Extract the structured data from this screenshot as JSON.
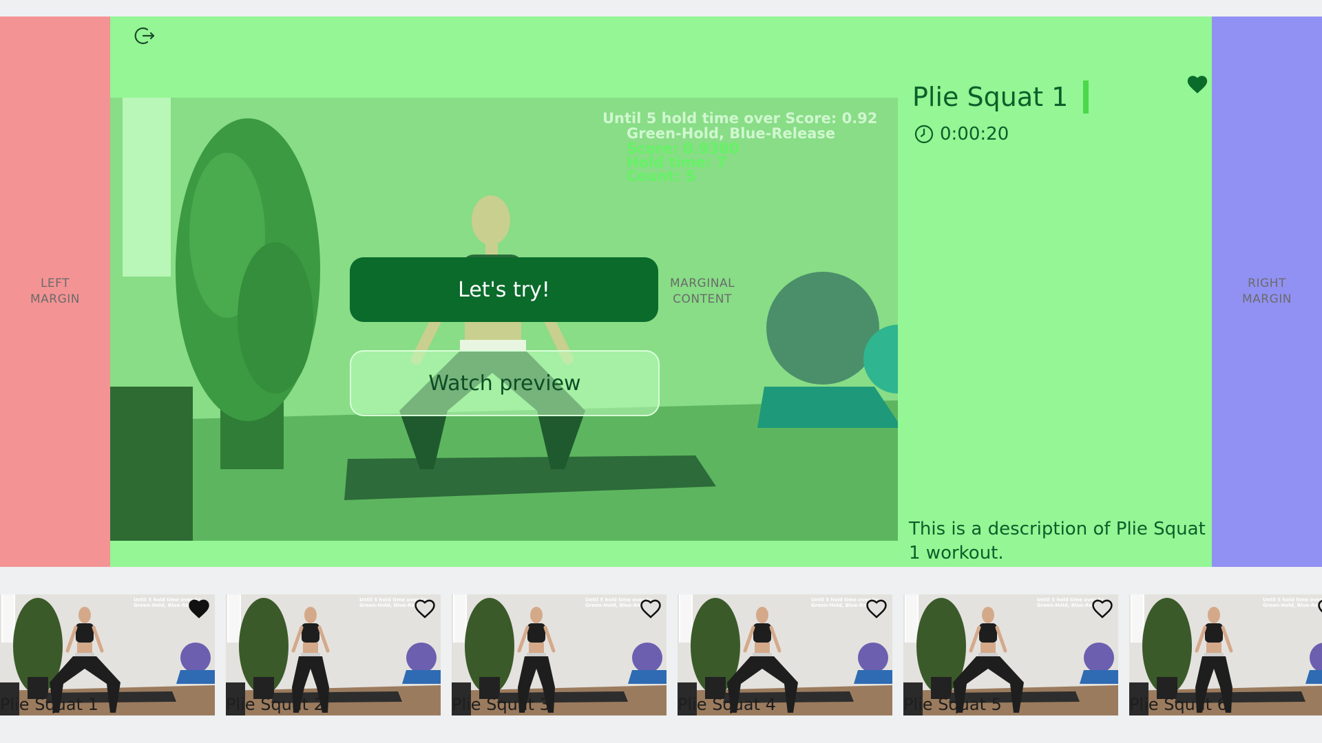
{
  "margins": {
    "left_label": "LEFT\nMARGIN",
    "right_label": "RIGHT\nMARGIN",
    "center_label": "MARGINAL\nCONTENT"
  },
  "video": {
    "overlay_lines": [
      "Until 5 hold time over Score: 0.92",
      "Green-Hold, Blue-Release",
      "Score: 0.9380",
      "Hold time: 7",
      "Count: 5"
    ]
  },
  "buttons": {
    "try_label": "Let's try!",
    "preview_label": "Watch preview"
  },
  "workout": {
    "title": "Plie Squat 1",
    "duration": "0:00:20",
    "description": "This is a description of Plie Squat 1 workout.",
    "favorited": true
  },
  "icons": {
    "exit": "exit-icon",
    "favorite": "heart-icon",
    "timer": "clock-icon"
  },
  "colors": {
    "content_bg": "#94f694",
    "left_margin": "#f49394",
    "right_margin": "#9191f3",
    "primary_button": "#0a6b2b",
    "accent_bar": "#4bd84b"
  },
  "carousel": {
    "items": [
      {
        "label": "Plie Squat 1",
        "favorited": true,
        "overlay": [
          "Until 5 hold time over Sc",
          "Green-Hold, Blue-Rel"
        ]
      },
      {
        "label": "Plie Squat 2",
        "favorited": false,
        "overlay": [
          "Until 5 hold time over Sc",
          "Green-Hold, Blue-Rel"
        ]
      },
      {
        "label": "Plie Squat 3",
        "favorited": false,
        "overlay": [
          "Until 5 hold time over Sc",
          "Green-Hold, Blue-Rel"
        ]
      },
      {
        "label": "Plie Squat 4",
        "favorited": false,
        "overlay": [
          "Until 5 hold time over Sc",
          "Green-Hold, Blue-Rel"
        ]
      },
      {
        "label": "Plie Squat 5",
        "favorited": false,
        "overlay": [
          "Until 5 hold time over Sc",
          "Green-Hold, Blue-Rel"
        ]
      },
      {
        "label": "Plie Squat 6",
        "favorited": false,
        "overlay": [
          "Until 5 hold time over Sc",
          "Green-Hold, Blue-Rel"
        ]
      }
    ]
  }
}
